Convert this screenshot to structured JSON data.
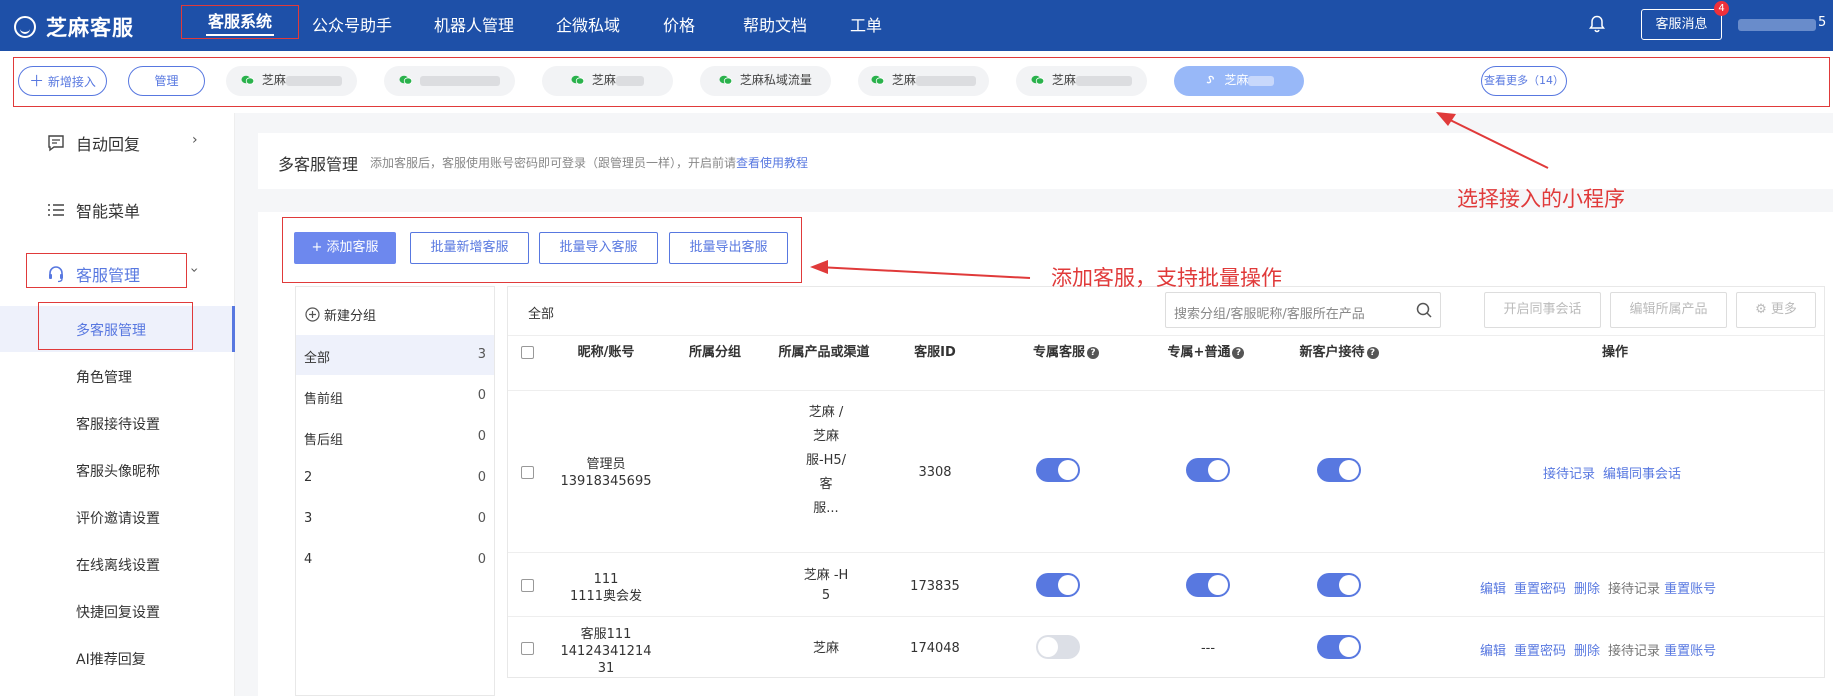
{
  "brand": {
    "name": "芝麻客服"
  },
  "topnav": {
    "items": [
      "客服系统",
      "公众号助手",
      "机器人管理",
      "企微私域",
      "价格",
      "帮助文档",
      "工单"
    ],
    "message_button": "客服消息",
    "message_badge": "4",
    "user_tail": "5"
  },
  "channels": {
    "add": "新增接入",
    "manage": "管理",
    "items": [
      {
        "label": "芝麻"
      },
      {
        "label": ""
      },
      {
        "label": "芝麻"
      },
      {
        "label": "芝麻私域流量"
      },
      {
        "label": "芝麻"
      },
      {
        "label": "芝麻"
      },
      {
        "label": "芝麻"
      }
    ],
    "more": "查看更多（14）"
  },
  "sidebar": {
    "auto_reply": "自动回复",
    "smart_menu": "智能菜单",
    "cs_manage": "客服管理",
    "sub": [
      "多客服管理",
      "角色管理",
      "客服接待设置",
      "客服头像昵称",
      "评价邀请设置",
      "在线离线设置",
      "快捷回复设置",
      "AI推荐回复"
    ]
  },
  "desc": {
    "title": "多客服管理",
    "text": "添加客服后，客服使用账号密码即可登录（跟管理员一样），开启前请",
    "link": "查看使用教程"
  },
  "toolbar": {
    "add": "+ 添加客服",
    "batch_new": "批量新增客服",
    "batch_import": "批量导入客服",
    "batch_export": "批量导出客服"
  },
  "groups": {
    "new_group": "新建分组",
    "items": [
      {
        "name": "全部",
        "count": "3"
      },
      {
        "name": "售前组",
        "count": "0"
      },
      {
        "name": "售后组",
        "count": "0"
      },
      {
        "name": "2",
        "count": "0"
      },
      {
        "name": "3",
        "count": "0"
      },
      {
        "name": "4",
        "count": "0"
      }
    ]
  },
  "table": {
    "title": "全部",
    "search_placeholder": "搜索分组/客服昵称/客服所在产品",
    "buttons": [
      "开启同事会话",
      "编辑所属产品",
      "更多"
    ],
    "headers": {
      "nickname": "昵称/账号",
      "group": "所属分组",
      "channel": "所属产品或渠道",
      "id": "客服ID",
      "dedicated": "专属客服",
      "dedicated_normal": "专属+普通",
      "new_customer": "新客户接待",
      "ops": "操作"
    },
    "rows": [
      {
        "nick": "管理员",
        "account": "13918345695",
        "channel_lines": [
          "芝麻     /",
          "芝麻     ",
          "           ",
          "服-H5/     ",
          "         客",
          "服..."
        ],
        "id": "3308",
        "dedicated": true,
        "dedicated_normal": "on",
        "new_customer": true,
        "ops": [
          "接待记录",
          "编辑同事会话"
        ]
      },
      {
        "nick": "111",
        "account": "1111奥会发",
        "channel_lines": [
          "芝麻      -H",
          "5"
        ],
        "id": "173835",
        "dedicated": true,
        "dedicated_normal": "on",
        "new_customer": true,
        "ops": [
          "编辑",
          "重置密码",
          "删除",
          "接待记录",
          "重置账号"
        ]
      },
      {
        "nick": "客服111",
        "account": "14124341214",
        "account2": "31",
        "channel_lines": [
          "芝麻      "
        ],
        "id": "174048",
        "dedicated": false,
        "dedicated_normal": "---",
        "new_customer": true,
        "ops": [
          "编辑",
          "重置密码",
          "删除",
          "接待记录",
          "重置账号"
        ]
      }
    ]
  },
  "annotations": {
    "select_mini": "选择接入的小程序",
    "add_batch": "添加客服，支持批量操作"
  },
  "colors": {
    "nav_bg": "#1e50a8",
    "accent": "#5878e0",
    "annotation": "#e03a3a"
  }
}
